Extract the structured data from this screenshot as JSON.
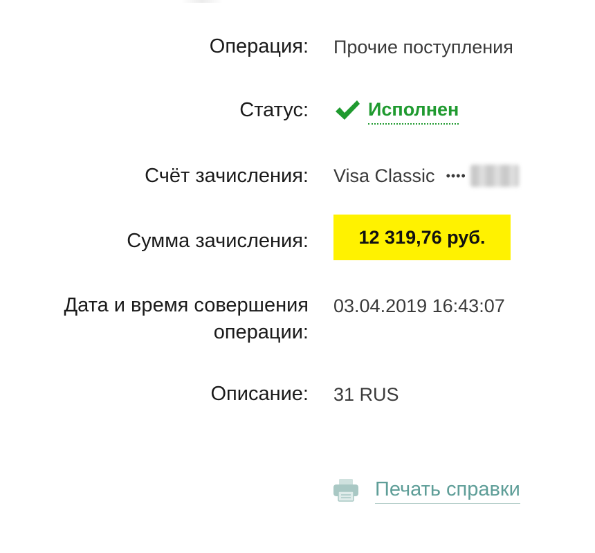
{
  "details": {
    "operation": {
      "label": "Операция:",
      "value": "Прочие поступления"
    },
    "status": {
      "label": "Статус:",
      "value": "Исполнен",
      "icon": "checkmark-icon",
      "color": "#1f9a2f"
    },
    "account": {
      "label": "Счёт зачисления:",
      "card_name": "Visa Classic",
      "masked_dots": "••••"
    },
    "amount": {
      "label": "Сумма зачисления:",
      "value": "12 319,76 руб.",
      "highlight_color": "#fff200"
    },
    "datetime": {
      "label_line1": "Дата и время совершения",
      "label_line2": "операции:",
      "value": "03.04.2019 16:43:07"
    },
    "description": {
      "label": "Описание:",
      "value": "31 RUS"
    }
  },
  "actions": {
    "print_label": "Печать справки",
    "print_icon": "printer-icon",
    "print_color": "#5f9e98"
  }
}
